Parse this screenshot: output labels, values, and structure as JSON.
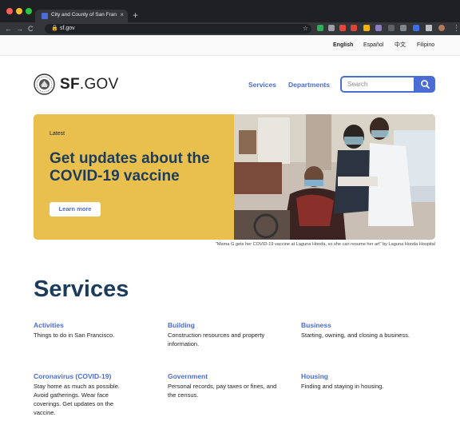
{
  "browser": {
    "tab_title": "City and County of San Francisco",
    "tab_close": "×",
    "new_tab": "+",
    "back": "←",
    "forward": "→",
    "reload": "C",
    "lock": "🔒",
    "url": "sf.gov",
    "bookmark": "☆",
    "menu": "⋮"
  },
  "languages": [
    "English",
    "Español",
    "中文",
    "Filipino"
  ],
  "header": {
    "brand_bold": "SF",
    "brand_rest": ".GOV",
    "nav": [
      "Services",
      "Departments"
    ],
    "search_placeholder": "Search"
  },
  "hero": {
    "eyebrow": "Latest",
    "title": "Get updates about the COVID-19 vaccine",
    "button": "Learn more",
    "caption": "\"Mama G gets her COVID-19 vaccine at Laguna Honda, so she can resume her art\" by Laguna Honda Hospital"
  },
  "services": {
    "heading": "Services",
    "items": [
      {
        "title": "Activities",
        "desc": "Things to do in San Francisco."
      },
      {
        "title": "Building",
        "desc": "Construction resources and property information."
      },
      {
        "title": "Business",
        "desc": "Starting, owning, and closing a business."
      },
      {
        "title": "Coronavirus (COVID-19)",
        "desc": "Stay home as much as possible. Avoid gatherings. Wear face coverings. Get updates on the vaccine."
      },
      {
        "title": "Government",
        "desc": "Personal records, pay taxes or fines, and the census."
      },
      {
        "title": "Housing",
        "desc": "Finding and staying in housing."
      }
    ]
  },
  "colors": {
    "accent": "#4a6cd4",
    "hero_yellow": "#e9c04e",
    "navy": "#1d3c5c",
    "chrome_dark": "#35363a"
  }
}
